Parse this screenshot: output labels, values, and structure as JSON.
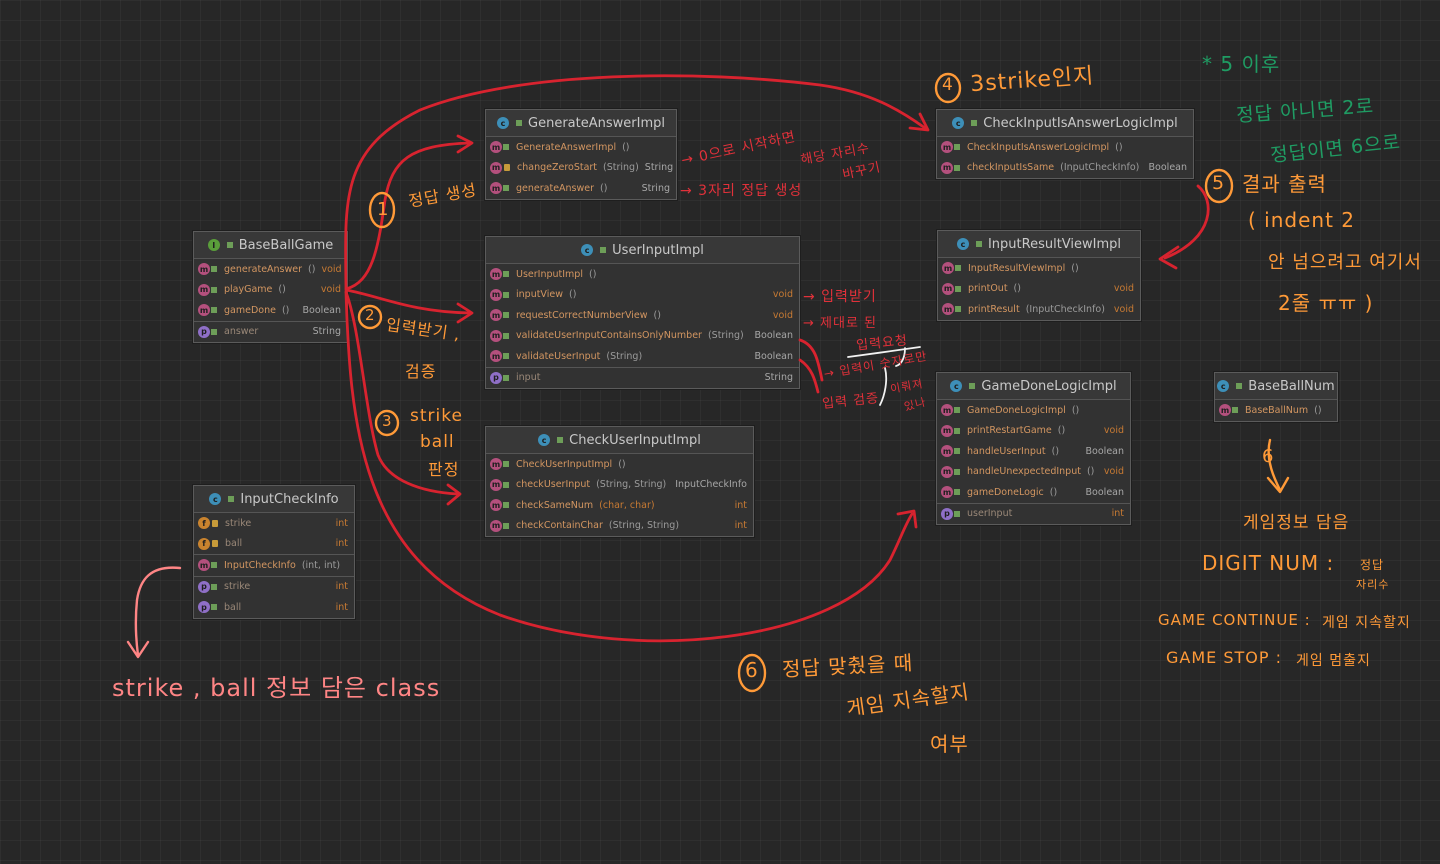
{
  "classes": {
    "baseball_game": {
      "name": "BaseBallGame",
      "members": [
        {
          "name": "generateAnswer",
          "params": "()",
          "type": "void"
        },
        {
          "name": "playGame",
          "params": "()",
          "type": "void"
        },
        {
          "name": "gameDone",
          "params": "()",
          "type": "Boolean"
        },
        {
          "name": "answer",
          "params": "",
          "type": "String"
        }
      ]
    },
    "generate_answer_impl": {
      "name": "GenerateAnswerImpl",
      "members": [
        {
          "name": "GenerateAnswerImpl",
          "params": "()",
          "type": ""
        },
        {
          "name": "changeZeroStart",
          "params": "(String)",
          "type": "String"
        },
        {
          "name": "generateAnswer",
          "params": "()",
          "type": "String"
        }
      ]
    },
    "user_input_impl": {
      "name": "UserInputImpl",
      "members": [
        {
          "name": "UserInputImpl",
          "params": "()",
          "type": ""
        },
        {
          "name": "inputView",
          "params": "()",
          "type": "void"
        },
        {
          "name": "requestCorrectNumberView",
          "params": "()",
          "type": "void"
        },
        {
          "name": "validateUserInputContainsOnlyNumber",
          "params": "(String)",
          "type": "Boolean"
        },
        {
          "name": "validateUserInput",
          "params": "(String)",
          "type": "Boolean"
        },
        {
          "name": "input",
          "params": "",
          "type": "String"
        }
      ]
    },
    "check_user_input_impl": {
      "name": "CheckUserInputImpl",
      "members": [
        {
          "name": "CheckUserInputImpl",
          "params": "()",
          "type": ""
        },
        {
          "name": "checkUserInput",
          "params": "(String, String)",
          "type": "InputCheckInfo"
        },
        {
          "name": "checkSameNum",
          "params": "(char, char)",
          "type": "int"
        },
        {
          "name": "checkContainChar",
          "params": "(String, String)",
          "type": "int"
        }
      ]
    },
    "input_check_info": {
      "name": "InputCheckInfo",
      "members": [
        {
          "name": "strike",
          "params": "",
          "type": "int"
        },
        {
          "name": "ball",
          "params": "",
          "type": "int"
        },
        {
          "name": "InputCheckInfo",
          "params": "(int, int)",
          "type": ""
        },
        {
          "name": "strike",
          "params": "",
          "type": "int"
        },
        {
          "name": "ball",
          "params": "",
          "type": "int"
        }
      ]
    },
    "check_input_is_answer": {
      "name": "CheckInputIsAnswerLogicImpl",
      "members": [
        {
          "name": "CheckInputIsAnswerLogicImpl",
          "params": "()",
          "type": ""
        },
        {
          "name": "checkInputIsSame",
          "params": "(InputCheckInfo)",
          "type": "Boolean"
        }
      ]
    },
    "input_result_view": {
      "name": "InputResultViewImpl",
      "members": [
        {
          "name": "InputResultViewImpl",
          "params": "()",
          "type": ""
        },
        {
          "name": "printOut",
          "params": "()",
          "type": "void"
        },
        {
          "name": "printResult",
          "params": "(InputCheckInfo)",
          "type": "void"
        }
      ]
    },
    "game_done_logic": {
      "name": "GameDoneLogicImpl",
      "members": [
        {
          "name": "GameDoneLogicImpl",
          "params": "()",
          "type": ""
        },
        {
          "name": "printRestartGame",
          "params": "()",
          "type": "void"
        },
        {
          "name": "handleUserInput",
          "params": "()",
          "type": "Boolean"
        },
        {
          "name": "handleUnexpectedInput",
          "params": "()",
          "type": "void"
        },
        {
          "name": "gameDoneLogic",
          "params": "()",
          "type": "Boolean"
        },
        {
          "name": "userInput",
          "params": "",
          "type": "int"
        }
      ]
    },
    "baseball_num": {
      "name": "BaseBallNum",
      "members": [
        {
          "name": "BaseBallNum",
          "params": "()",
          "type": ""
        }
      ]
    }
  },
  "annotations": {
    "step1_num": "1",
    "step1": "정답 생성",
    "step2_num": "2",
    "step2a": "입력받기 ,",
    "step2b": "검증",
    "step3_num": "3",
    "step3a": "strike",
    "step3b": "ball",
    "step3c": "판정",
    "step4_num": "4",
    "step4": "3strike인지",
    "step5_num": "5",
    "step5": "결과 출력",
    "step5b": "( indent 2",
    "step5c": "안 넘으려고 여기서",
    "step5d": "2줄 ㅠㅠ )",
    "step6_num": "6",
    "step6a": "정답 맞췄을 때",
    "step6b": "게임 지속할지",
    "step6c": "여부",
    "zero_a": "→ 0으로 시작하면",
    "zero_b": "해당 자리수",
    "zero_c": "바꾸기",
    "three_digit": "→ 3자리 정답 생성",
    "input_recv": "→ 입력받기",
    "proper_a": "→ 제대로 된",
    "proper_b": "입력요청",
    "check_a": "→ 입력이 숫자로만",
    "check_b": "이뤄져",
    "check_c": "입력 검증",
    "check_d": "있나",
    "green_a": "* 5 이후",
    "green_b": "정답 아니면 2로",
    "green_c": "정답이면 6으로",
    "info_note": "strike , ball 정보 담은 class",
    "bbn_num": "6",
    "bbn_note": "게임정보 담음",
    "digit_num": "DIGIT NUM  :",
    "digit_desc_a": "정답",
    "digit_desc_b": "자리수",
    "game_continue": "GAME CONTINUE :",
    "game_continue_desc": "게임 지속할지",
    "game_stop": "GAME STOP  :",
    "game_stop_desc": "게임 멈출지"
  },
  "colors": {
    "red": "#e0313a",
    "orange": "#ff9a38",
    "pink": "#ff8585",
    "green": "#1f9c63"
  }
}
